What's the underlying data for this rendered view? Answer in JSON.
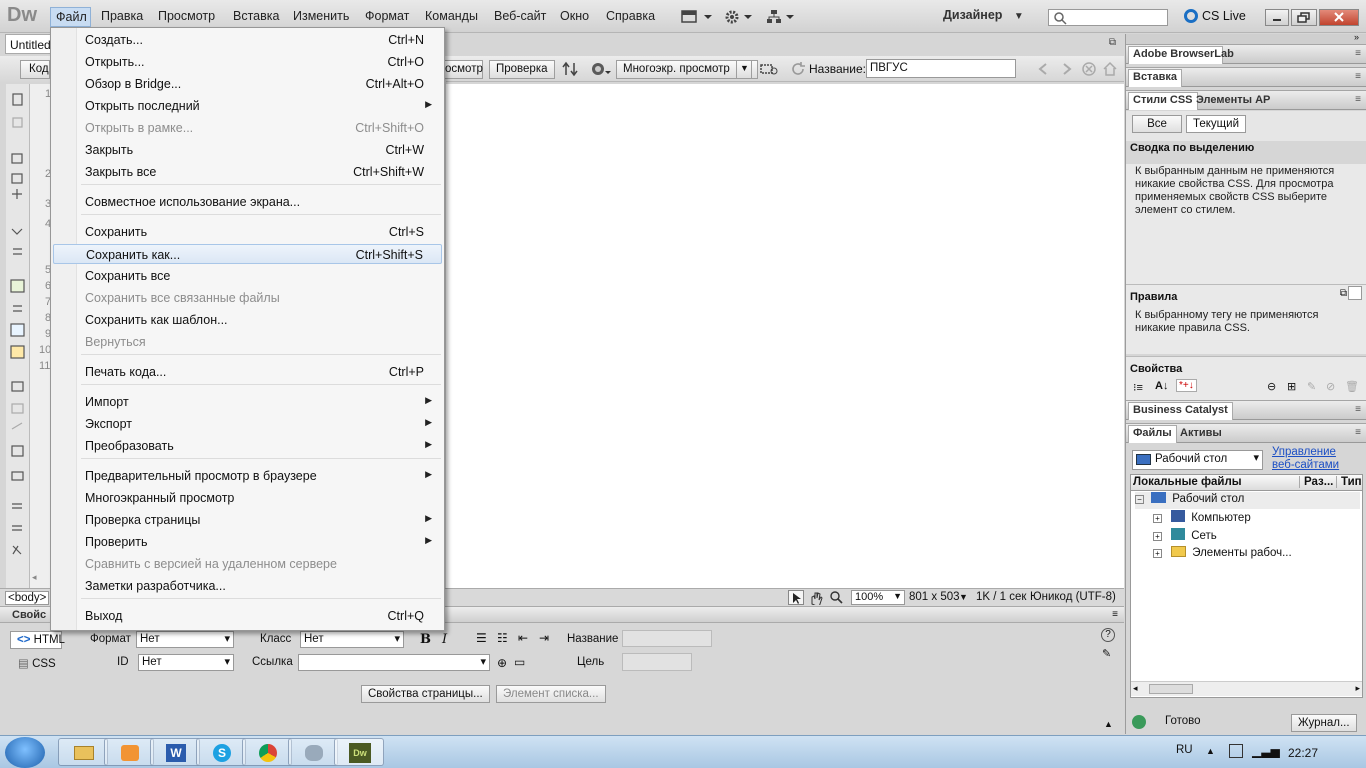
{
  "app": {
    "logo": "Dw"
  },
  "menubar": {
    "items": [
      "Файл",
      "Правка",
      "Просмотр",
      "Вставка",
      "Изменить",
      "Формат",
      "Команды",
      "Веб-сайт",
      "Окно",
      "Справка"
    ],
    "workspace": "Дизайнер",
    "cs_live": "CS Live"
  },
  "document": {
    "tab": "Untitled",
    "code_btn": "Код",
    "buttons": {
      "preview": "осмотр",
      "check": "Проверка",
      "multiscreen": "Многоэкр. просмотр"
    },
    "title_label": "Название:",
    "title_value": "ПВГУС",
    "line_numbers": [
      "1",
      "2",
      "3",
      "4",
      "5",
      "6",
      "7",
      "8",
      "9",
      "10",
      "11"
    ]
  },
  "statusbar": {
    "tag": "<body>",
    "zoom": "100%",
    "size": "801 x 503",
    "speed": "1K / 1 сек",
    "encoding": "Юникод (UTF-8)"
  },
  "properties": {
    "header": "Свойс",
    "html_btn": "HTML",
    "css_btn": "CSS",
    "format_label": "Формат",
    "format_value": "Нет",
    "class_label": "Класс",
    "class_value": "Нет",
    "id_label": "ID",
    "id_value": "Нет",
    "link_label": "Ссылка",
    "title_label": "Название",
    "target_label": "Цель",
    "page_props_btn": "Свойства страницы...",
    "list_item_btn": "Элемент списка..."
  },
  "right_panels": {
    "browserlab": "Adobe BrowserLab",
    "insert": "Вставка",
    "css_tab": "Стили CSS",
    "ap_tab": "Элементы AP",
    "all_btn": "Все",
    "current_btn": "Текущий",
    "summary_title": "Сводка по выделению",
    "summary_text": [
      "К выбранным данным не применяются",
      "никакие свойства CSS.  Для просмотра",
      "применяемых свойств CSS выберите",
      "элемент со стилем."
    ],
    "rules_title": "Правила",
    "rules_text": [
      "К выбранному тегу не применяются",
      "никакие правила CSS."
    ],
    "props_title": "Свойства",
    "bc": "Business Catalyst",
    "files_tab": "Файлы",
    "assets_tab": "Активы",
    "location": "Рабочий стол",
    "manage_link": [
      "Управление",
      "веб-сайтами"
    ],
    "col_local": "Локальные файлы",
    "col_size": "Раз...",
    "col_type": "Тип",
    "tree": [
      "Рабочий стол",
      "Компьютер",
      "Сеть",
      "Элементы рабоч..."
    ],
    "status": "Готово",
    "log_btn": "Журнал..."
  },
  "taskbar": {
    "lang": "RU",
    "time": "22:27"
  },
  "file_menu": [
    {
      "label": "Создать...",
      "shortcut": "Ctrl+N"
    },
    {
      "label": "Открыть...",
      "shortcut": "Ctrl+O"
    },
    {
      "label": "Обзор в Bridge...",
      "shortcut": "Ctrl+Alt+O"
    },
    {
      "label": "Открыть последний",
      "submenu": true
    },
    {
      "label": "Открыть в рамке...",
      "shortcut": "Ctrl+Shift+O",
      "disabled": true
    },
    {
      "label": "Закрыть",
      "shortcut": "Ctrl+W"
    },
    {
      "label": "Закрыть все",
      "shortcut": "Ctrl+Shift+W"
    },
    {
      "label": "Совместное использование экрана..."
    },
    {
      "label": "Сохранить",
      "shortcut": "Ctrl+S"
    },
    {
      "label": "Сохранить как...",
      "shortcut": "Ctrl+Shift+S",
      "highlighted": true
    },
    {
      "label": "Сохранить все"
    },
    {
      "label": "Сохранить все связанные файлы",
      "disabled": true
    },
    {
      "label": "Сохранить как шаблон..."
    },
    {
      "label": "Вернуться",
      "disabled": true
    },
    {
      "label": "Печать кода...",
      "shortcut": "Ctrl+P"
    },
    {
      "label": "Импорт",
      "submenu": true
    },
    {
      "label": "Экспорт",
      "submenu": true
    },
    {
      "label": "Преобразовать",
      "submenu": true
    },
    {
      "label": "Предварительный просмотр в браузере",
      "submenu": true
    },
    {
      "label": "Многоэкранный просмотр"
    },
    {
      "label": "Проверка страницы",
      "submenu": true
    },
    {
      "label": "Проверить",
      "submenu": true
    },
    {
      "label": "Сравнить с версией на удаленном сервере",
      "disabled": true
    },
    {
      "label": "Заметки разработчика..."
    },
    {
      "label": "Выход",
      "shortcut": "Ctrl+Q"
    }
  ]
}
